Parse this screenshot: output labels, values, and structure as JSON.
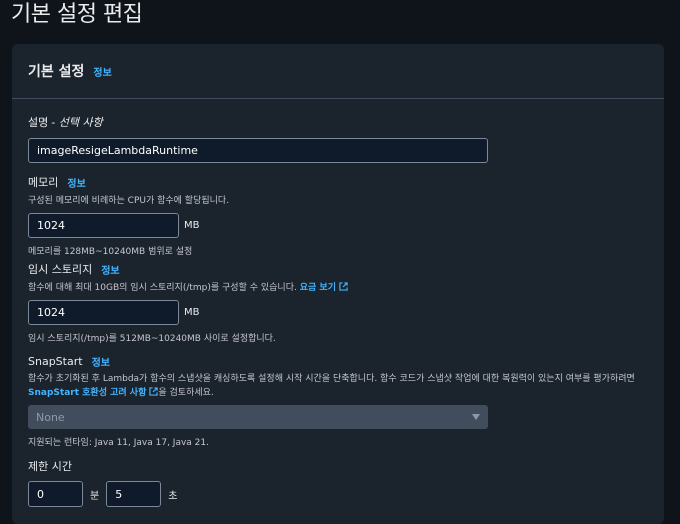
{
  "page": {
    "title": "기본 설정 편집"
  },
  "panel": {
    "title": "기본 설정",
    "info": "정보"
  },
  "description": {
    "label": "설명",
    "optional": "- 선택 사항",
    "value": "imageResigeLambdaRuntime"
  },
  "memory": {
    "label": "메모리",
    "info": "정보",
    "desc": "구성된 메모리에 비례하는 CPU가 함수에 할당됩니다.",
    "value": "1024",
    "unit": "MB",
    "hint": "메모리를 128MB~10240MB 범위로 설정"
  },
  "storage": {
    "label": "임시 스토리지",
    "info": "정보",
    "desc": "함수에 대해 최대 10GB의 임시 스토리지(/tmp)를 구성할 수 있습니다.",
    "link": "요금 보기",
    "value": "1024",
    "unit": "MB",
    "hint": "임시 스토리지(/tmp)를 512MB~10240MB 사이로 설정합니다."
  },
  "snapstart": {
    "label": "SnapStart",
    "info": "정보",
    "desc1": "함수가 초기화된 후 Lambda가 함수의 스냅샷을 캐싱하도록 설정해 시작 시간을 단축합니다. 함수 코드가 스냅샷 작업에 대한 복원력이 있는지 여부를 평가하려면",
    "link": "SnapStart 호환성 고려 사항",
    "desc2": "을 검토하세요.",
    "selected": "None",
    "hint": "지원되는 런타임: Java 11, Java 17, Java 21."
  },
  "timeout": {
    "label": "제한 시간",
    "minutes": "0",
    "minutes_unit": "분",
    "seconds": "5",
    "seconds_unit": "초"
  },
  "colors": {
    "accent": "#42b4ff",
    "panel": "#1b232d",
    "background": "#0f141a"
  }
}
